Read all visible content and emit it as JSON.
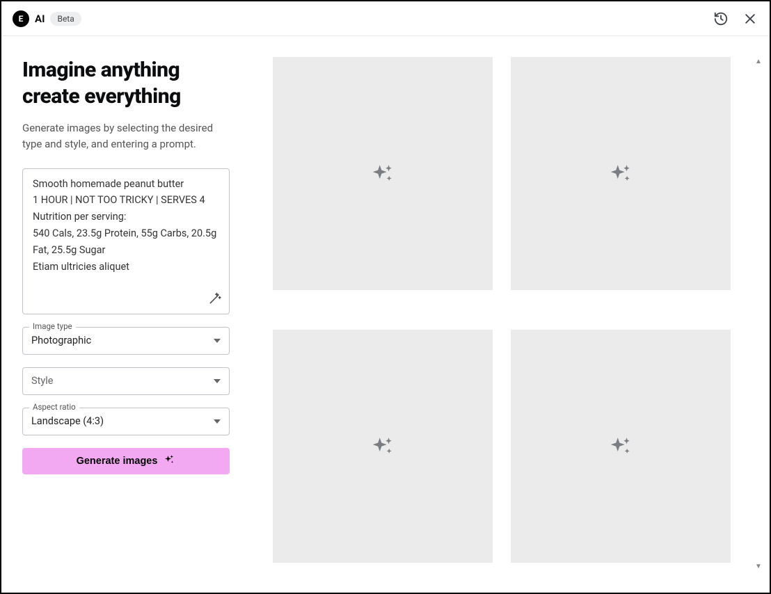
{
  "header": {
    "logo_letter": "E",
    "ai_label": "AI",
    "beta_label": "Beta"
  },
  "sidebar": {
    "title": "Imagine anything create everything",
    "subtitle": "Generate images by selecting the desired type and style, and entering a prompt.",
    "prompt_value": "Smooth homemade peanut butter\n1 HOUR | NOT TOO TRICKY | SERVES 4\nNutrition per serving:\n540 Cals, 23.5g Protein, 55g Carbs, 20.5g Fat, 25.5g Sugar\nEtiam ultricies aliquet",
    "image_type": {
      "label": "Image type",
      "value": "Photographic"
    },
    "style": {
      "placeholder": "Style"
    },
    "aspect_ratio": {
      "label": "Aspect ratio",
      "value": "Landscape (4:3)"
    },
    "generate_label": "Generate images"
  }
}
